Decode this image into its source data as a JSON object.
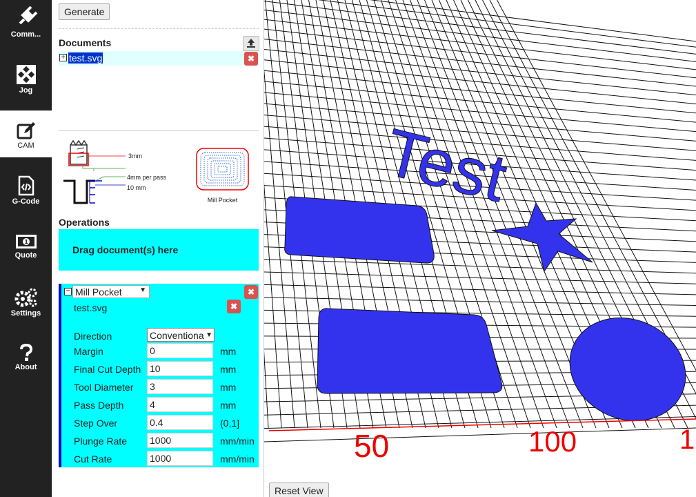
{
  "nav": {
    "items": [
      {
        "label": "Comm...",
        "icon": "plug-icon"
      },
      {
        "label": "Jog",
        "icon": "arrows-icon"
      },
      {
        "label": "CAM",
        "icon": "edit-icon"
      },
      {
        "label": "G-Code",
        "icon": "code-file-icon"
      },
      {
        "label": "Quote",
        "icon": "money-icon"
      },
      {
        "label": "Settings",
        "icon": "gears-icon"
      },
      {
        "label": "About",
        "icon": "question-icon"
      }
    ],
    "active": "CAM"
  },
  "panel": {
    "generate_label": "Generate",
    "documents_title": "Documents",
    "document_name": "test.svg",
    "diagram": {
      "label_3mm": "3mm",
      "label_pass": "4mm per pass",
      "label_10mm": "10 mm",
      "thumb_label": "Mill Pocket"
    },
    "operations_title": "Operations",
    "drop_text": "Drag document(s) here",
    "operation": {
      "type": "Mill Pocket",
      "doc": "test.svg",
      "fields": [
        {
          "label": "Direction",
          "value": "Conventional",
          "unit": ""
        },
        {
          "label": "Margin",
          "value": "0",
          "unit": "mm"
        },
        {
          "label": "Final Cut Depth",
          "value": "10",
          "unit": "mm"
        },
        {
          "label": "Tool Diameter",
          "value": "3",
          "unit": "mm"
        },
        {
          "label": "Pass Depth",
          "value": "4",
          "unit": "mm"
        },
        {
          "label": "Step Over",
          "value": "0.4",
          "unit": "(0,1]"
        },
        {
          "label": "Plunge Rate",
          "value": "1000",
          "unit": "mm/min"
        },
        {
          "label": "Cut Rate",
          "value": "1000",
          "unit": "mm/min"
        }
      ]
    }
  },
  "view": {
    "text": "Test",
    "axis_labels": [
      "50",
      "100",
      "1"
    ],
    "reset_label": "Reset View",
    "shape_color": "#3333ee",
    "axis_color": "#ee0000"
  },
  "colors": {
    "accent": "#00ffff",
    "nav_bg": "#222222",
    "remove": "#d9534f"
  }
}
